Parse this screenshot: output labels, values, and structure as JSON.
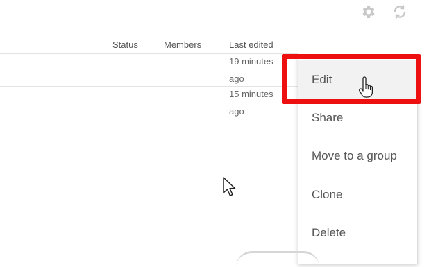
{
  "toolbar": {
    "settings_icon": "gear-icon",
    "sync_icon": "sync-icon"
  },
  "table": {
    "columns": [
      "Status",
      "Members",
      "Last edited"
    ],
    "rows": [
      {
        "last_edited": [
          "19 minutes",
          "ago"
        ]
      },
      {
        "last_edited": [
          "15 minutes",
          "ago"
        ]
      }
    ]
  },
  "menu": {
    "items": [
      "Edit",
      "Share",
      "Move to a group",
      "Clone",
      "Delete"
    ],
    "highlighted": "Edit"
  },
  "colors": {
    "highlight": "#ee1010",
    "icon": "#c8c8c8"
  }
}
